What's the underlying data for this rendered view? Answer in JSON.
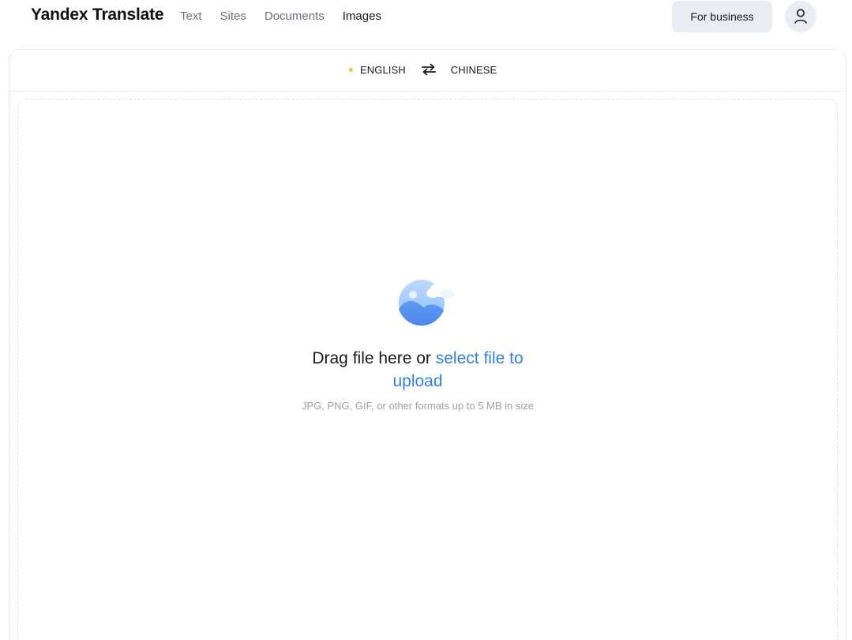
{
  "header": {
    "logo": "Yandex Translate",
    "nav": [
      {
        "label": "Text",
        "active": false
      },
      {
        "label": "Sites",
        "active": false
      },
      {
        "label": "Documents",
        "active": false
      },
      {
        "label": "Images",
        "active": true
      }
    ],
    "business_button": "For business",
    "avatar_icon": "user-icon"
  },
  "languages": {
    "source": "ENGLISH",
    "target": "CHINESE",
    "swap_icon": "swap-arrows-icon",
    "source_indicator_color": "#f6c232"
  },
  "upload": {
    "illustration_icon": "image-upload-icon",
    "prompt_prefix": "Drag file here or ",
    "prompt_link": "select file to upload",
    "hint": "JPG, PNG, GIF, or other formats up to 5 MB in size"
  },
  "colors": {
    "accent": "#2f7ff2",
    "button_bg": "#e9ecf2",
    "indicator": "#f6c232"
  }
}
